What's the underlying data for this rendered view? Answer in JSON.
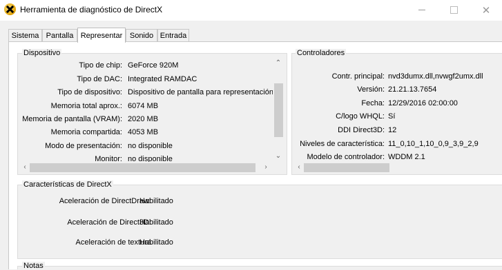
{
  "window": {
    "title": "Herramienta de diagnóstico de DirectX"
  },
  "tabs": [
    {
      "label": "Sistema"
    },
    {
      "label": "Pantalla"
    },
    {
      "label": "Representar"
    },
    {
      "label": "Sonido"
    },
    {
      "label": "Entrada"
    }
  ],
  "dispositivo": {
    "title": "Dispositivo",
    "rows": [
      {
        "label": "Tipo de chip:",
        "value": "GeForce 920M"
      },
      {
        "label": "Tipo de DAC:",
        "value": "Integrated RAMDAC"
      },
      {
        "label": "Tipo de dispositivo:",
        "value": "Dispositivo de pantalla para representación"
      },
      {
        "label": "Memoria total aprox.:",
        "value": "6074 MB"
      },
      {
        "label": "Memoria de pantalla (VRAM):",
        "value": "2020 MB"
      },
      {
        "label": "Memoria compartida:",
        "value": "4053 MB"
      },
      {
        "label": "Modo de presentación:",
        "value": "no disponible"
      },
      {
        "label": "Monitor:",
        "value": "no disponible"
      }
    ]
  },
  "controladores": {
    "title": "Controladores",
    "rows": [
      {
        "label": "Contr. principal:",
        "value": "nvd3dumx.dll,nvwgf2umx.dll"
      },
      {
        "label": "Versión:",
        "value": "21.21.13.7654"
      },
      {
        "label": "Fecha:",
        "value": "12/29/2016 02:00:00"
      },
      {
        "label": "C/logo WHQL:",
        "value": "Sí"
      },
      {
        "label": "DDI Direct3D:",
        "value": "12"
      },
      {
        "label": "Niveles de característica:",
        "value": "11_0,10_1,10_0,9_3,9_2,9"
      },
      {
        "label": "Modelo de controlador:",
        "value": "WDDM 2.1"
      }
    ]
  },
  "caracteristicas": {
    "title": "Características de DirectX",
    "rows": [
      {
        "label": "Aceleración de DirectDraw:",
        "value": "Habilitado"
      },
      {
        "label": "Aceleración de Direct3D:",
        "value": "Habilitado"
      },
      {
        "label": "Aceleración de textura",
        "value": "Habilitado"
      }
    ]
  },
  "notas": {
    "title": "Notas"
  }
}
